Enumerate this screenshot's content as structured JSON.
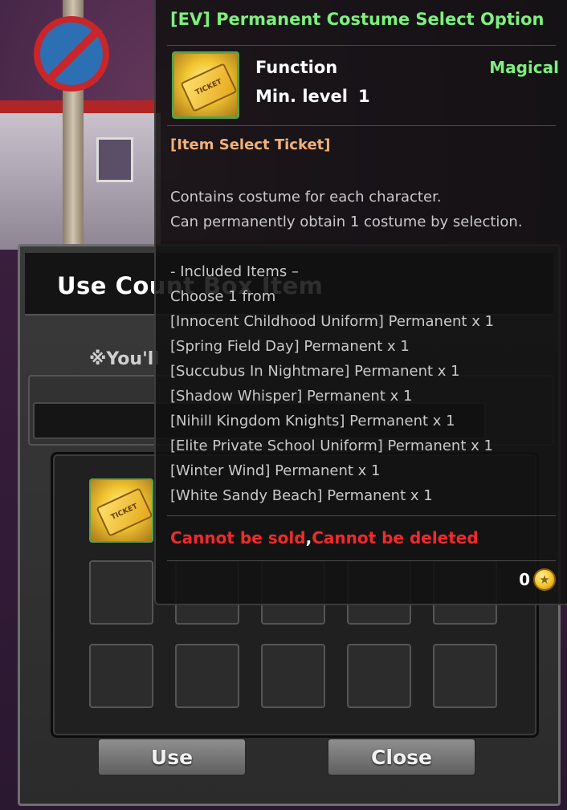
{
  "dialog": {
    "title": "Use Count Box Item",
    "notice": "※You'll",
    "buttons": {
      "use": "Use",
      "close": "Close"
    }
  },
  "tooltip": {
    "title": "[EV] Permanent Costume Select Option",
    "function_label": "Function",
    "min_level_label": "Min. level",
    "min_level_value": "1",
    "item_type": "Magical",
    "category": "[Item Select Ticket]",
    "description": [
      "Contains costume for each character.",
      "Can permanently obtain 1 costume by selection."
    ],
    "included_header": "- Included Items –",
    "choose_text": "Choose 1 from",
    "items": [
      "[Innocent Childhood Uniform] Permanent x 1",
      "[Spring Field Day] Permanent x 1",
      "[Succubus In Nightmare] Permanent x 1",
      "[Shadow Whisper] Permanent x 1",
      "[Nihill Kingdom Knights] Permanent x 1",
      "[Elite Private School Uniform] Permanent x 1",
      "[Winter Wind] Permanent x 1",
      "[White Sandy Beach] Permanent x 1"
    ],
    "restriction_1": "Cannot be sold",
    "restriction_sep": ",",
    "restriction_2": "Cannot be deleted",
    "price": "0"
  },
  "icons": {
    "ticket": "ticket-icon",
    "coin": "gold-coin-icon"
  },
  "colors": {
    "title_green": "#7df07d",
    "category_orange": "#f2b07a",
    "restriction_red": "#f02a2a"
  }
}
